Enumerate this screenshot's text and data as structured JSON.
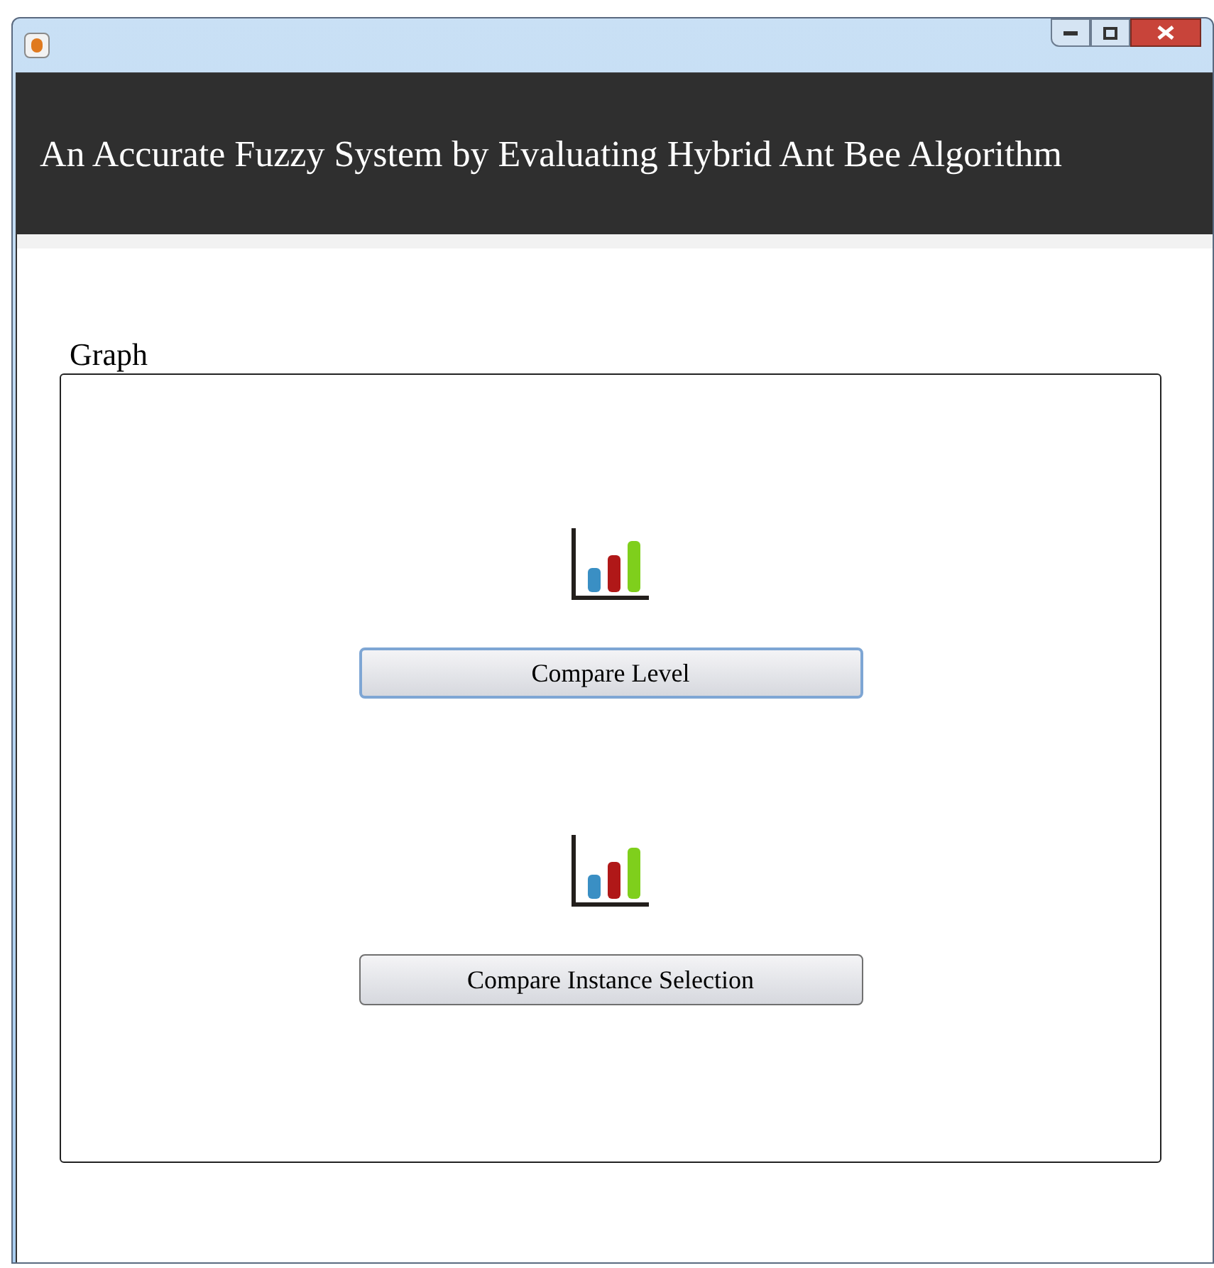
{
  "header": {
    "title": "An Accurate Fuzzy System by Evaluating Hybrid Ant Bee Algorithm"
  },
  "panel": {
    "label": "Graph",
    "buttons": [
      {
        "label": "Compare Level",
        "focused": true
      },
      {
        "label": "Compare Instance Selection",
        "focused": false
      }
    ]
  }
}
